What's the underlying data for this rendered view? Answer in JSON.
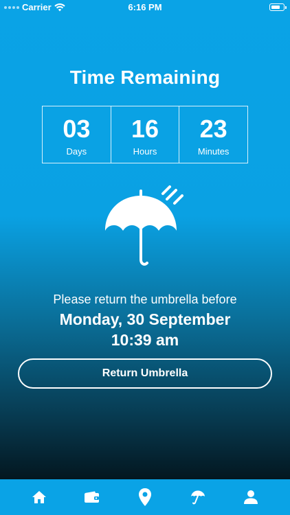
{
  "status_bar": {
    "carrier": "Carrier",
    "time": "6:16 PM",
    "battery_level": 0.8
  },
  "title": "Time Remaining",
  "countdown": [
    {
      "value": "03",
      "label": "Days"
    },
    {
      "value": "16",
      "label": "Hours"
    },
    {
      "value": "23",
      "label": "Minutes"
    }
  ],
  "illustration": {
    "icon": "umbrella-rain-icon"
  },
  "return_info": {
    "prompt": "Please return the umbrella before",
    "date": "Monday, 30 September",
    "time": "10:39 am"
  },
  "return_button_label": "Return Umbrella",
  "tab_bar": {
    "items": [
      {
        "icon": "home-icon"
      },
      {
        "icon": "wallet-icon"
      },
      {
        "icon": "location-pin-icon"
      },
      {
        "icon": "umbrella-icon"
      },
      {
        "icon": "profile-icon"
      }
    ]
  },
  "colors": {
    "accent": "#0aa3e6",
    "gradient_bottom": "#031218",
    "text": "#ffffff"
  }
}
